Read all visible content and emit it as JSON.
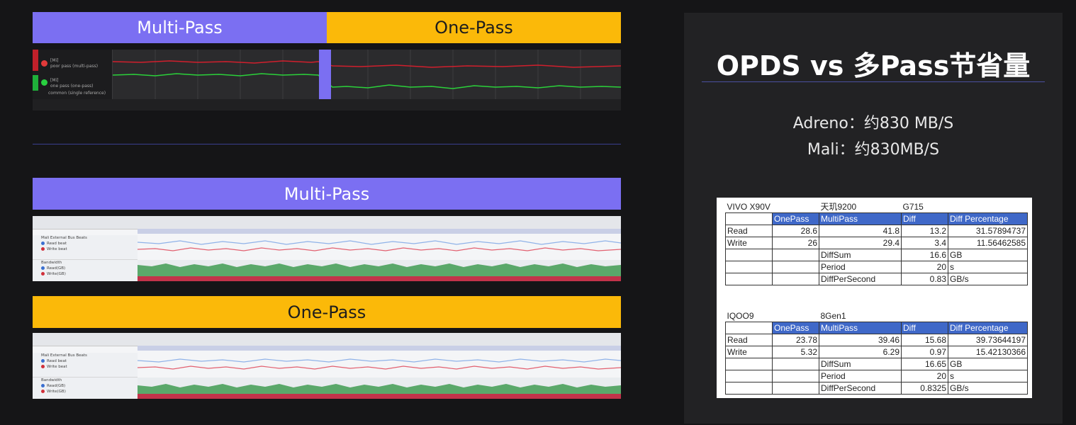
{
  "top_section": {
    "multi_pass_label": "Multi-Pass",
    "one_pass_label": "One-Pass",
    "trace_rows": [
      {
        "name": "[Mi]",
        "sub": "poor pass (multi-pass)"
      },
      {
        "name": "[Mi]",
        "sub": "one pass (one-pass)"
      },
      {
        "name": "",
        "sub": "common (single reference)"
      }
    ]
  },
  "mali_section": {
    "multi_pass_label": "Multi-Pass",
    "one_pass_label": "One-Pass",
    "rows": [
      {
        "title": "Mali External Bus Beats",
        "items": [
          "Read beat",
          "Write beat"
        ]
      },
      {
        "title": "Bandwidth",
        "items": [
          "Read(GB)",
          "Write(GB)"
        ]
      }
    ]
  },
  "panel": {
    "title": "OPDS vs 多Pass节省量",
    "adreno": "Adreno：约830 MB/S",
    "mali": "Mali：约830MB/S"
  },
  "table1": {
    "device": "VIVO X90V",
    "chip": "天玑9200",
    "gpu": "G715",
    "headers": [
      "",
      "OnePass",
      "MultiPass",
      "Diff",
      "Diff Percentage"
    ],
    "rows": [
      [
        "Read",
        "28.6",
        "41.8",
        "13.2",
        "31.57894737"
      ],
      [
        "Write",
        "26",
        "29.4",
        "3.4",
        "11.56462585"
      ],
      [
        "",
        "",
        "DiffSum",
        "16.6",
        "GB"
      ],
      [
        "",
        "",
        "Period",
        "20",
        "s"
      ],
      [
        "",
        "",
        "DiffPerSecond",
        "0.83",
        "GB/s"
      ]
    ]
  },
  "table2": {
    "device": "IQOO9",
    "chip": "8Gen1",
    "headers": [
      "",
      "OnePass",
      "MultiPass",
      "Diff",
      "Diff Percentage"
    ],
    "rows": [
      [
        "Read",
        "23.78",
        "39.46",
        "15.68",
        "39.73644197"
      ],
      [
        "Write",
        "5.32",
        "6.29",
        "0.97",
        "15.42130366"
      ],
      [
        "",
        "",
        "DiffSum",
        "16.65",
        "GB"
      ],
      [
        "",
        "",
        "Period",
        "20",
        "s"
      ],
      [
        "",
        "",
        "DiffPerSecond",
        "0.8325",
        "GB/s"
      ]
    ]
  },
  "colors": {
    "purple": "#7b6ff2",
    "orange": "#fbb909",
    "red_trace": "#d11f2d",
    "green_trace": "#2bd13a",
    "table_header": "#3f68c8"
  }
}
